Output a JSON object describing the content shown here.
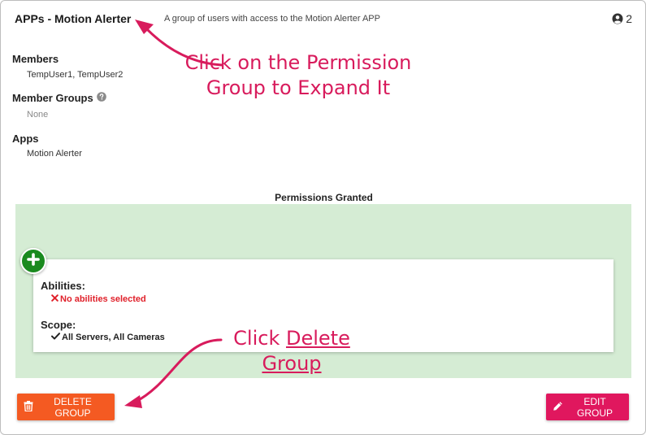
{
  "group": {
    "title": "APPs - Motion Alerter",
    "description": "A group of users with access to the Motion Alerter APP",
    "member_count": "2"
  },
  "details": {
    "members_label": "Members",
    "members_value": "TempUser1, TempUser2",
    "member_groups_label": "Member Groups",
    "member_groups_value": "None",
    "apps_label": "Apps",
    "apps_value": "Motion Alerter"
  },
  "permissions": {
    "title": "Permissions Granted",
    "abilities_label": "Abilities:",
    "abilities_value": "No abilities selected",
    "scope_label": "Scope:",
    "scope_value": "All Servers, All Cameras"
  },
  "buttons": {
    "delete_label": "DELETE GROUP",
    "edit_label": "EDIT GROUP"
  },
  "annotations": {
    "expand_text": "Click on the Permission Group to Expand It",
    "delete_prefix": "Click ",
    "delete_link": "Delete Group"
  },
  "colors": {
    "annotation": "#d81b5c",
    "delete_button": "#f45a22",
    "edit_button": "#e0175e",
    "permissions_bg": "#d5ecd4",
    "add_button": "#1a8a1f",
    "error_text": "#e0202a"
  },
  "icons": {
    "member_count": "user-circle-icon",
    "member_groups_help": "question-circle-icon",
    "add": "plus-icon",
    "abilities_status": "x-icon",
    "scope_status": "check-icon",
    "delete": "trash-icon",
    "edit": "pencil-icon"
  }
}
